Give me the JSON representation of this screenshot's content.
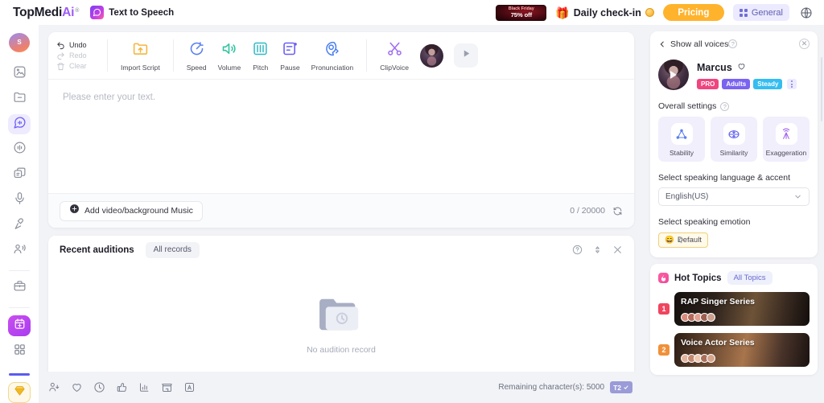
{
  "header": {
    "logo": {
      "part1": "TopMedi",
      "part2": "Ai",
      "reg": "®"
    },
    "product": {
      "name": "Text to Speech",
      "icon": "speech-bubble-icon"
    },
    "promo": {
      "line1": "Black Friday",
      "line2": "75% off"
    },
    "checkin": {
      "label": "Daily check-in",
      "gift_icon": "gift-icon",
      "coin_icon": "coin-icon"
    },
    "pricing_label": "Pricing",
    "general_label": "General",
    "globe_icon": "globe-icon"
  },
  "rail": {
    "avatar_initial": "S",
    "items": [
      {
        "name": "sidebar-item-image-edit",
        "icon": "image-edit-icon"
      },
      {
        "name": "sidebar-item-folder",
        "icon": "folder-minus-icon"
      },
      {
        "name": "sidebar-item-text-to-speech",
        "icon": "speech-bubble-icon",
        "active": true
      },
      {
        "name": "sidebar-item-voice-changer",
        "icon": "voice-circle-icon"
      },
      {
        "name": "sidebar-item-voice-clone",
        "icon": "layers-icon"
      },
      {
        "name": "sidebar-item-microphone",
        "icon": "microphone-icon"
      },
      {
        "name": "sidebar-item-recorder",
        "icon": "mic-stand-icon"
      },
      {
        "name": "sidebar-item-speaker-profile",
        "icon": "person-audio-icon"
      },
      {
        "name": "sidebar-item-toolbox",
        "icon": "briefcase-icon"
      }
    ],
    "calendar_icon": "calendar-gift-icon",
    "apps_icon": "grid-apps-icon",
    "diamond_icon": "diamond-icon"
  },
  "toolbar": {
    "undo": "Undo",
    "redo": "Redo",
    "clear": "Clear",
    "tools": [
      {
        "label": "Import Script",
        "icon": "import-script-icon",
        "color": "#f4b63f"
      },
      {
        "label": "Speed",
        "icon": "speed-gauge-icon",
        "color": "#5b7ff0"
      },
      {
        "label": "Volume",
        "icon": "volume-icon",
        "color": "#2fc4a0"
      },
      {
        "label": "Pitch",
        "icon": "pitch-sliders-icon",
        "color": "#2fb9c4"
      },
      {
        "label": "Pause",
        "icon": "pause-note-icon",
        "color": "#6b5df6"
      },
      {
        "label": "Pronunciation",
        "icon": "pronunciation-icon",
        "color": "#4a7ef0"
      },
      {
        "label": "ClipVoice",
        "icon": "scissors-icon",
        "color": "#a06ff0"
      }
    ],
    "avatar_name": "voice-avatar",
    "play_icon": "play-icon"
  },
  "editor": {
    "placeholder": "Please enter your text.",
    "add_media_label": "Add video/background Music",
    "char_count": "0 / 20000",
    "refresh_icon": "refresh-icon"
  },
  "auditions": {
    "title": "Recent auditions",
    "all_records_label": "All records",
    "help_icon": "help-circle-icon",
    "collapse_icon": "expand-vertical-icon",
    "close_icon": "close-icon",
    "empty_text": "No audition record",
    "empty_icon": "empty-folder-icon"
  },
  "bottom_bar": {
    "icons": [
      {
        "name": "share-user-icon"
      },
      {
        "name": "heart-icon"
      },
      {
        "name": "history-clock-icon"
      },
      {
        "name": "thumbs-up-icon"
      },
      {
        "name": "chart-bars-icon"
      },
      {
        "name": "store-icon"
      },
      {
        "name": "text-format-icon"
      }
    ],
    "remaining_label": "Remaining character(s): 5000",
    "badge_text": "T2"
  },
  "right_panel": {
    "back_label": "Show all voices",
    "close_icon": "close-circle-icon",
    "voice": {
      "name": "Marcus",
      "favorite_icon": "heart-outline-icon",
      "tags": [
        {
          "label": "PRO",
          "color": "#f0457f"
        },
        {
          "label": "Adults",
          "color": "#7a63f0"
        },
        {
          "label": "Steady",
          "color": "#34bdf0"
        }
      ],
      "more_icon": "more-vertical-icon"
    },
    "overall_settings_label": "Overall settings",
    "settings": [
      {
        "label": "Stability",
        "icon": "stability-triangle-icon",
        "color": "#5b7ff0"
      },
      {
        "label": "Similarity",
        "icon": "similarity-icon",
        "color": "#5b5bf0"
      },
      {
        "label": "Exaggeration",
        "icon": "exaggeration-antenna-icon",
        "color": "#a060f0"
      }
    ],
    "language_label": "Select speaking language & accent",
    "language_value": "English(US)",
    "emotion_label": "Select speaking emotion",
    "emotion_value": "Default",
    "emotion_emoji": "😄",
    "hot_topics": {
      "title": "Hot Topics",
      "all_label": "All Topics",
      "fire_icon": "fire-icon",
      "items": [
        {
          "rank": "1",
          "title": "RAP Singer Series",
          "rank_color": "#f0455f"
        },
        {
          "rank": "2",
          "title": "Voice Actor Series",
          "rank_color": "#f0903a"
        }
      ]
    }
  }
}
